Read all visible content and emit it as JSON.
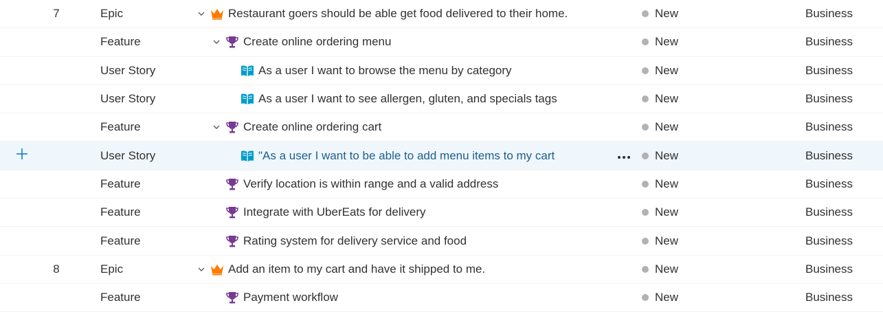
{
  "colors": {
    "epic_icon": "#ff7b00",
    "feature_icon": "#773b93",
    "story_icon": "#009ccc",
    "state_new_dot": "#b2b2b2",
    "selected_row_bg": "#eff6fc",
    "selected_title": "#1f5f8b",
    "add_icon": "#0078d4"
  },
  "icons": {
    "epic": "crown-icon",
    "feature": "trophy-icon",
    "user_story": "book-icon",
    "expand": "chevron-down-icon",
    "add": "plus-icon",
    "more": "more-horizontal-icon"
  },
  "rows": [
    {
      "order": "7",
      "type": "Epic",
      "title": "Restaurant goers should be able get food delivered to their home.",
      "state": "New",
      "area": "Business"
    },
    {
      "order": "",
      "type": "Feature",
      "title": "Create online ordering menu",
      "state": "New",
      "area": "Business"
    },
    {
      "order": "",
      "type": "User Story",
      "title": "As a user I want to browse the menu by category",
      "state": "New",
      "area": "Business"
    },
    {
      "order": "",
      "type": "User Story",
      "title": "As a user I want to see allergen, gluten, and specials tags",
      "state": "New",
      "area": "Business"
    },
    {
      "order": "",
      "type": "Feature",
      "title": "Create online ordering cart",
      "state": "New",
      "area": "Business"
    },
    {
      "order": "",
      "type": "User Story",
      "title": "\"As a user I want to be able to add menu items to my cart",
      "state": "New",
      "area": "Business"
    },
    {
      "order": "",
      "type": "Feature",
      "title": "Verify location is within range and a valid address",
      "state": "New",
      "area": "Business"
    },
    {
      "order": "",
      "type": "Feature",
      "title": "Integrate with UberEats for delivery",
      "state": "New",
      "area": "Business"
    },
    {
      "order": "",
      "type": "Feature",
      "title": "Rating system for delivery service and food",
      "state": "New",
      "area": "Business"
    },
    {
      "order": "8",
      "type": "Epic",
      "title": "Add an item to my cart and have it shipped to me.",
      "state": "New",
      "area": "Business"
    },
    {
      "order": "",
      "type": "Feature",
      "title": "Payment workflow",
      "state": "New",
      "area": "Business"
    }
  ]
}
